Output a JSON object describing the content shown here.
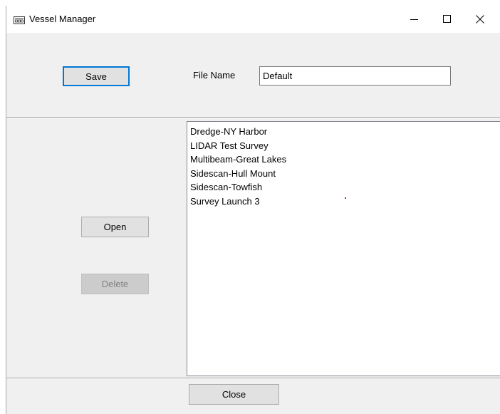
{
  "window": {
    "title": "Vessel Manager",
    "icon": "vessel-app-icon",
    "controls": {
      "minimize": "minimize-icon",
      "maximize": "maximize-icon",
      "close": "close-icon"
    }
  },
  "toolbar": {
    "save_label": "Save",
    "file_name_label": "File Name",
    "file_name_value": "Default"
  },
  "vessels": [
    {
      "label": "Dredge-NY Harbor"
    },
    {
      "label": "LIDAR Test Survey"
    },
    {
      "label": "Multibeam-Great Lakes"
    },
    {
      "label": "Sidescan-Hull Mount"
    },
    {
      "label": "Sidescan-Towfish"
    },
    {
      "label": "Survey Launch 3"
    }
  ],
  "actions": {
    "open_label": "Open",
    "delete_label": "Delete",
    "delete_enabled": false,
    "close_label": "Close"
  },
  "colors": {
    "focus_border": "#0078d7",
    "window_bg": "#f0f0f0",
    "disabled_text": "#838383"
  }
}
